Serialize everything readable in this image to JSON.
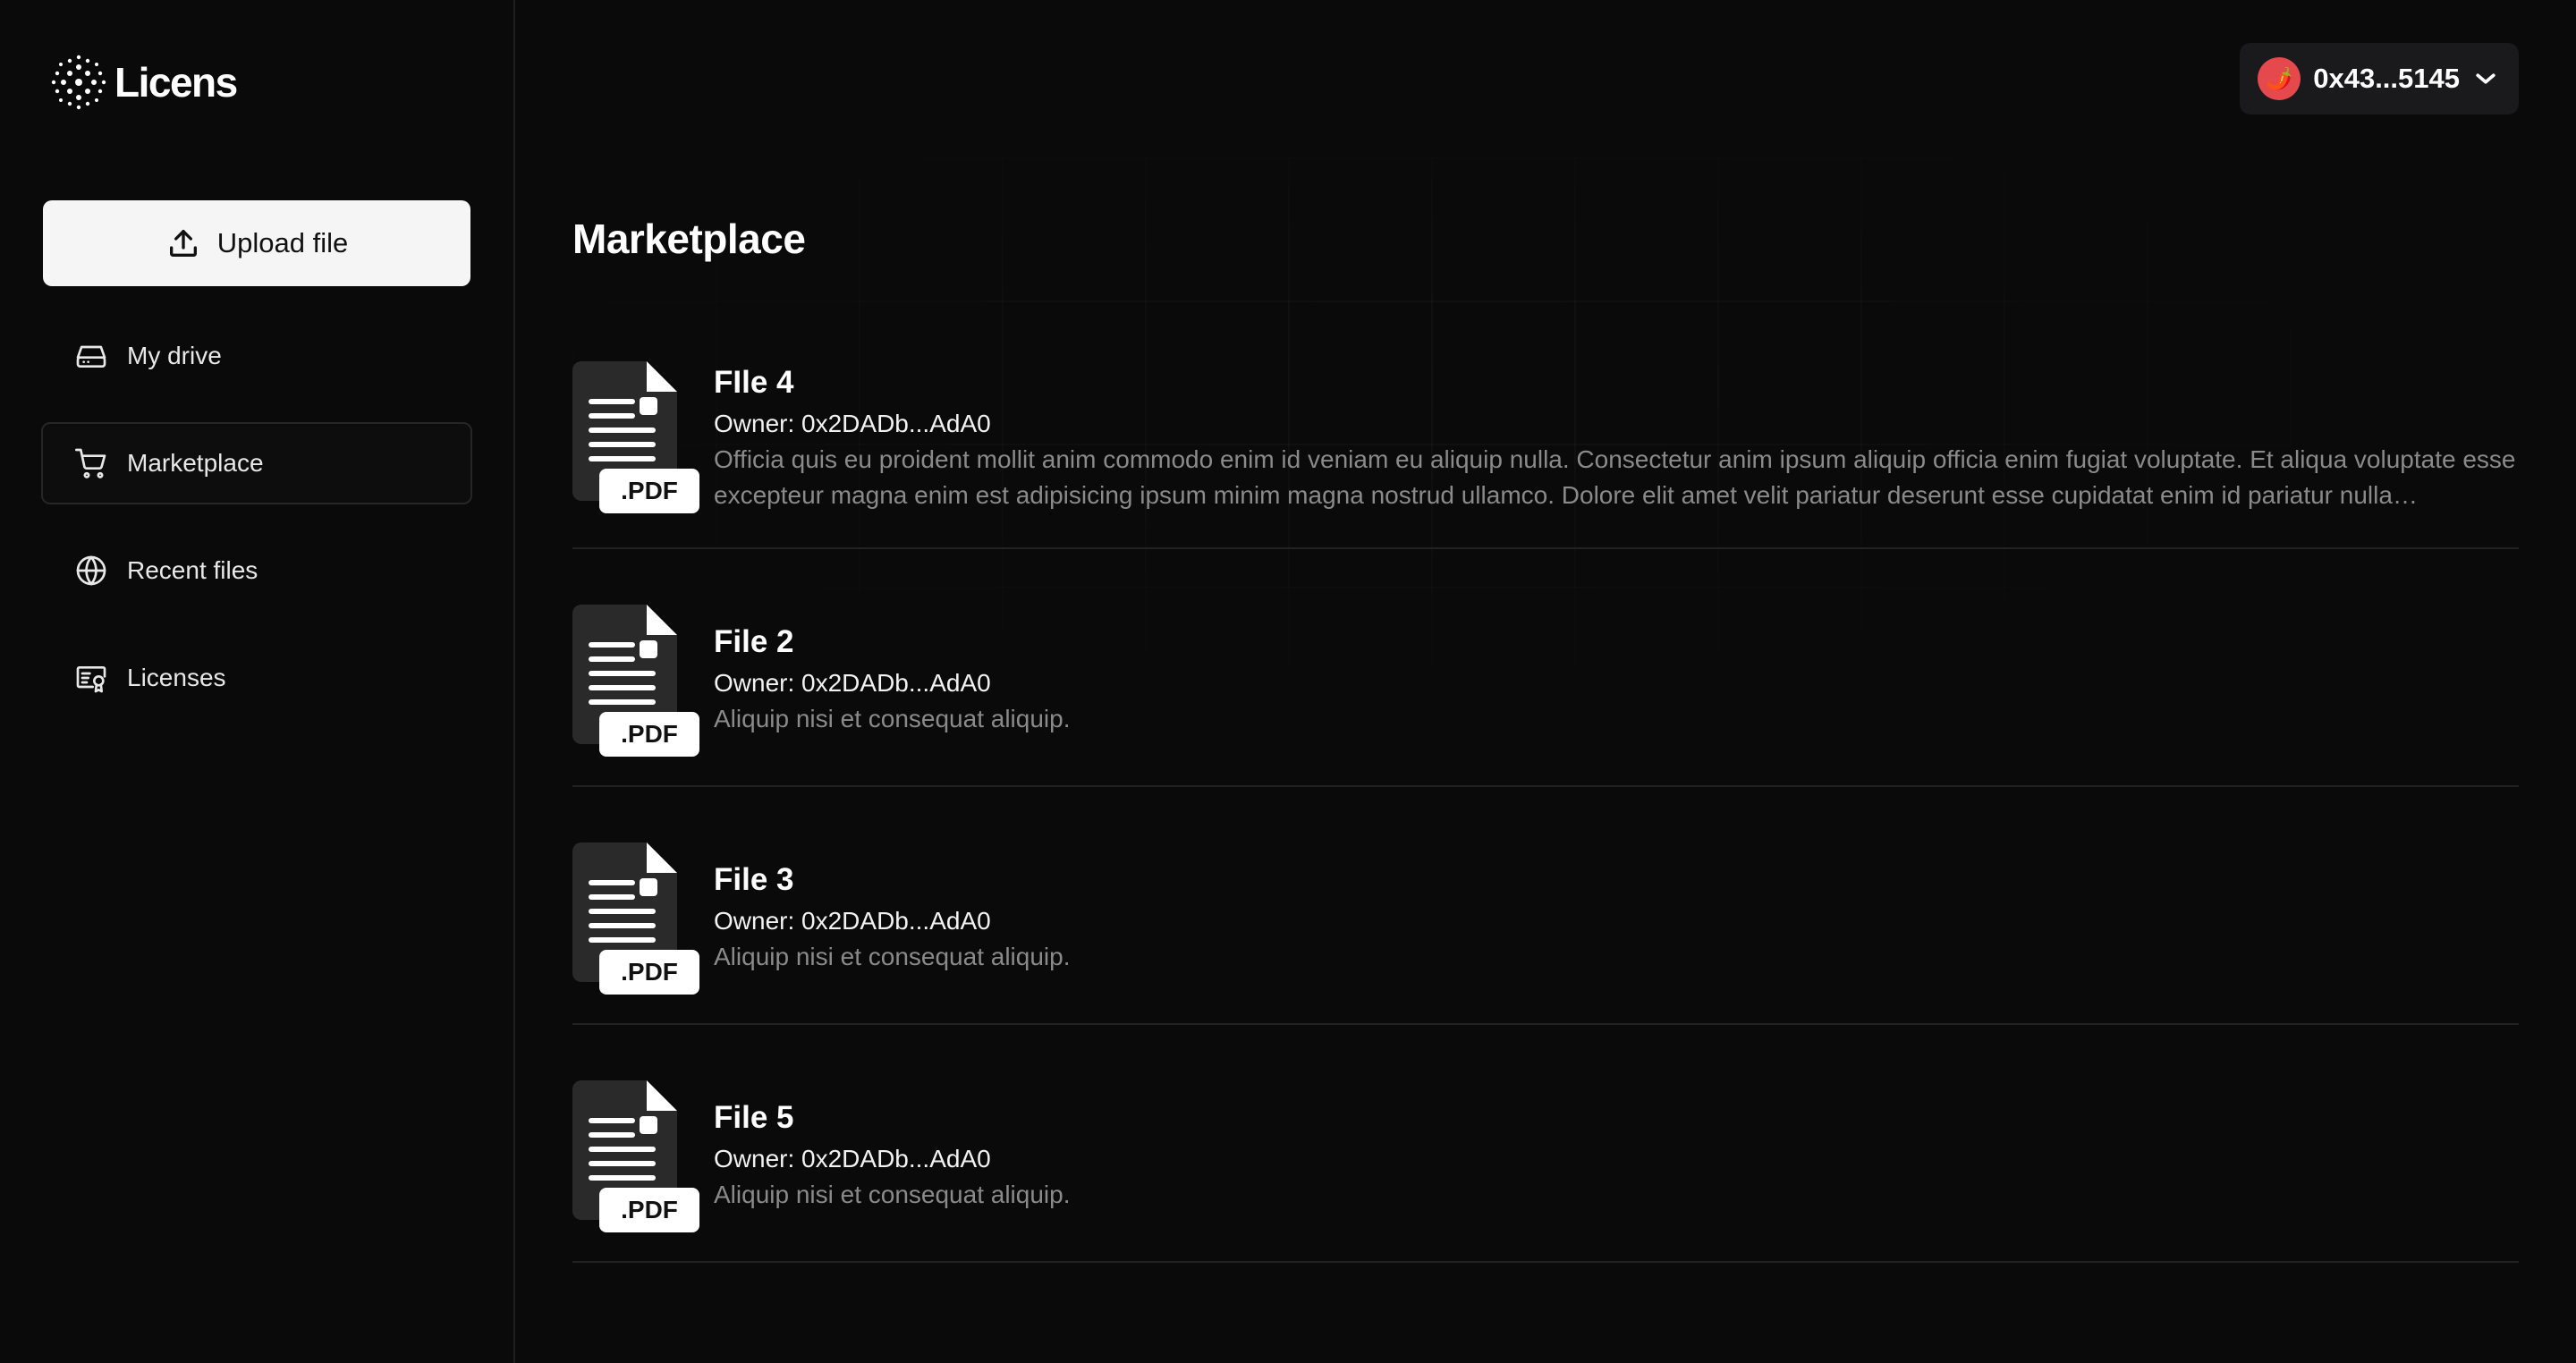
{
  "brand": {
    "name": "Licens"
  },
  "sidebar": {
    "upload_label": "Upload file",
    "items": [
      {
        "label": "My drive",
        "icon": "hard-drive-icon"
      },
      {
        "label": "Marketplace",
        "icon": "cart-icon",
        "active": true
      },
      {
        "label": "Recent files",
        "icon": "globe-icon"
      },
      {
        "label": "Licenses",
        "icon": "license-icon"
      }
    ]
  },
  "header": {
    "wallet": {
      "address": "0x43...5145",
      "avatar": "🌶️",
      "avatar_color": "#e5484d"
    }
  },
  "main": {
    "title": "Marketplace",
    "files": [
      {
        "title": "FIle 4",
        "owner": "Owner: 0x2DADb...AdA0",
        "description": "Officia quis eu proident mollit anim commodo enim id veniam eu aliquip nulla. Consectetur anim ipsum aliquip officia enim fugiat voluptate. Et aliqua voluptate esse excepteur magna enim est adipisicing ipsum minim magna nostrud ullamco. Dolore elit amet velit pariatur deserunt esse cupidatat enim id pariatur nulla exercitation...",
        "badge": ".PDF"
      },
      {
        "title": "File 2",
        "owner": "Owner: 0x2DADb...AdA0",
        "description": "Aliquip nisi et consequat aliquip.",
        "badge": ".PDF"
      },
      {
        "title": "File 3",
        "owner": "Owner: 0x2DADb...AdA0",
        "description": "Aliquip nisi et consequat aliquip.",
        "badge": ".PDF"
      },
      {
        "title": "File 5",
        "owner": "Owner: 0x2DADb...AdA0",
        "description": "Aliquip nisi et consequat aliquip.",
        "badge": ".PDF"
      }
    ]
  },
  "colors": {
    "background": "#0a0a0a",
    "border": "#222222",
    "muted_text": "#8a8a8a",
    "upload_button": "#f5f5f5"
  }
}
